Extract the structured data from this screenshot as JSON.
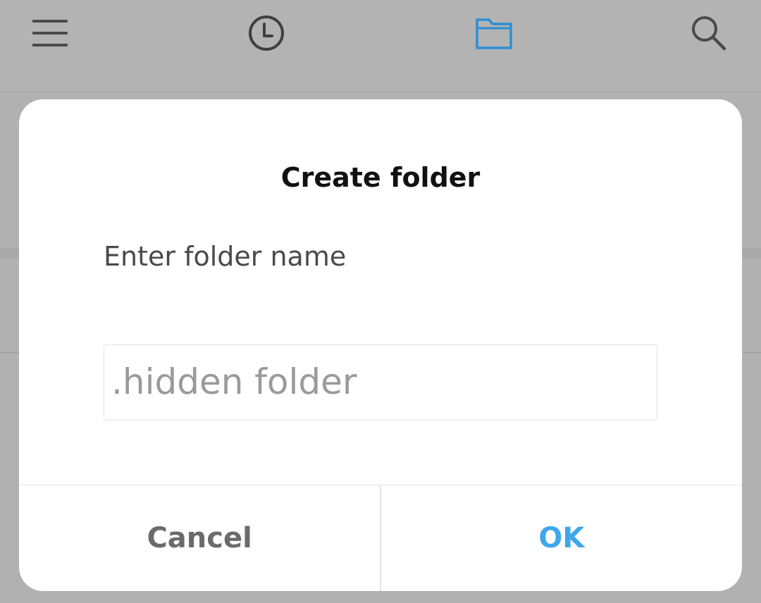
{
  "toolbar": {
    "menu_icon": "hamburger-menu-icon",
    "recent_icon": "clock-icon",
    "files_icon": "folder-icon",
    "search_icon": "search-icon",
    "active_color": "#2b8fd6",
    "icon_color": "#4a4a4a"
  },
  "dialog": {
    "title": "Create folder",
    "message": "Enter folder name",
    "input": {
      "value": ".hidden folder",
      "placeholder": ""
    },
    "cancel_label": "Cancel",
    "ok_label": "OK",
    "ok_color": "#3ea7ec"
  }
}
